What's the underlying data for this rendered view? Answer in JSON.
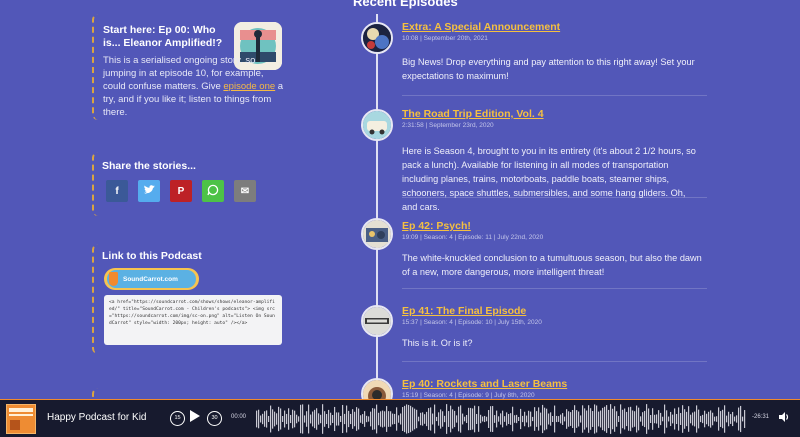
{
  "sidebar": {
    "start": {
      "title": "Start here: Ep 00: Who is... Eleanor Amplified!?",
      "body_before": "This is a serialised ongoing story, so jumping in at episode 10, for example, could confuse matters. Give ",
      "link": "episode one",
      "body_after": " a try, and if you like it; listen to things from there."
    },
    "share": {
      "title": "Share the stories...",
      "buttons": [
        {
          "label": "f",
          "icon": "facebook-icon",
          "color": "#3b5998"
        },
        {
          "label": "t",
          "icon": "twitter-icon",
          "color": "#55acee"
        },
        {
          "label": "P",
          "icon": "pinterest-icon",
          "color": "#bd2126"
        },
        {
          "label": "w",
          "icon": "whatsapp-icon",
          "color": "#4dc247"
        },
        {
          "label": "✉",
          "icon": "email-icon",
          "color": "#7d7d7d"
        }
      ]
    },
    "link_podcast": {
      "title": "Link to this Podcast",
      "badge": "SoundCarrot.com",
      "code": "<a href=\"https://soundcarrot.com/shows/shows/eleanor-amplified/\" title=\"SoundCarrot.com - Children's podcasts\"> <img src=\"https://soundcarrot.com/img/sc-on.png\" alt=\"Listen On SoundCarrot\" style=\"width: 200px; height: auto\" /></a>"
    }
  },
  "main": {
    "title": "Recent Episodes",
    "episodes": [
      {
        "title": "Extra: A Special Announcement",
        "meta": "10:08 | September 20th, 2021",
        "body": "Big News! Drop everything and pay attention to this right away! Set your expectations to maximum!"
      },
      {
        "title": "The Road Trip Edition, Vol. 4",
        "meta": "2:31:58 | September 23rd, 2020",
        "body": "Here is Season 4, brought to you in its entirety (it's about 2 1/2 hours, so pack a lunch). Available for listening in all modes of transportation including planes, trains, motorboats, paddle boats, steamer ships, schooners, space shuttles, submersibles, and some hang gliders. Oh, and cars."
      },
      {
        "title": "Ep 42: Psych!",
        "meta": "19:09 | Season: 4 | Episode: 11 | July 22nd, 2020",
        "body": "The white-knuckled conclusion to a tumultuous season, but also the dawn of a new, more dangerous, more intelligent threat!"
      },
      {
        "title": "Ep 41: The Final Episode",
        "meta": "15:37 | Season: 4 | Episode: 10 | July 15th, 2020",
        "body": "This is it. Or is it?"
      },
      {
        "title": "Ep 40: Rockets and Laser Beams",
        "meta": "15:19 | Season: 4 | Episode: 9 | July 8th, 2020",
        "body": ""
      }
    ]
  },
  "player": {
    "title": "Happy Podcast for Kid",
    "rewind_label": "15",
    "forward_label": "30",
    "current_time": "00:00",
    "duration": "-26:31",
    "accent": "#f08a2c"
  }
}
